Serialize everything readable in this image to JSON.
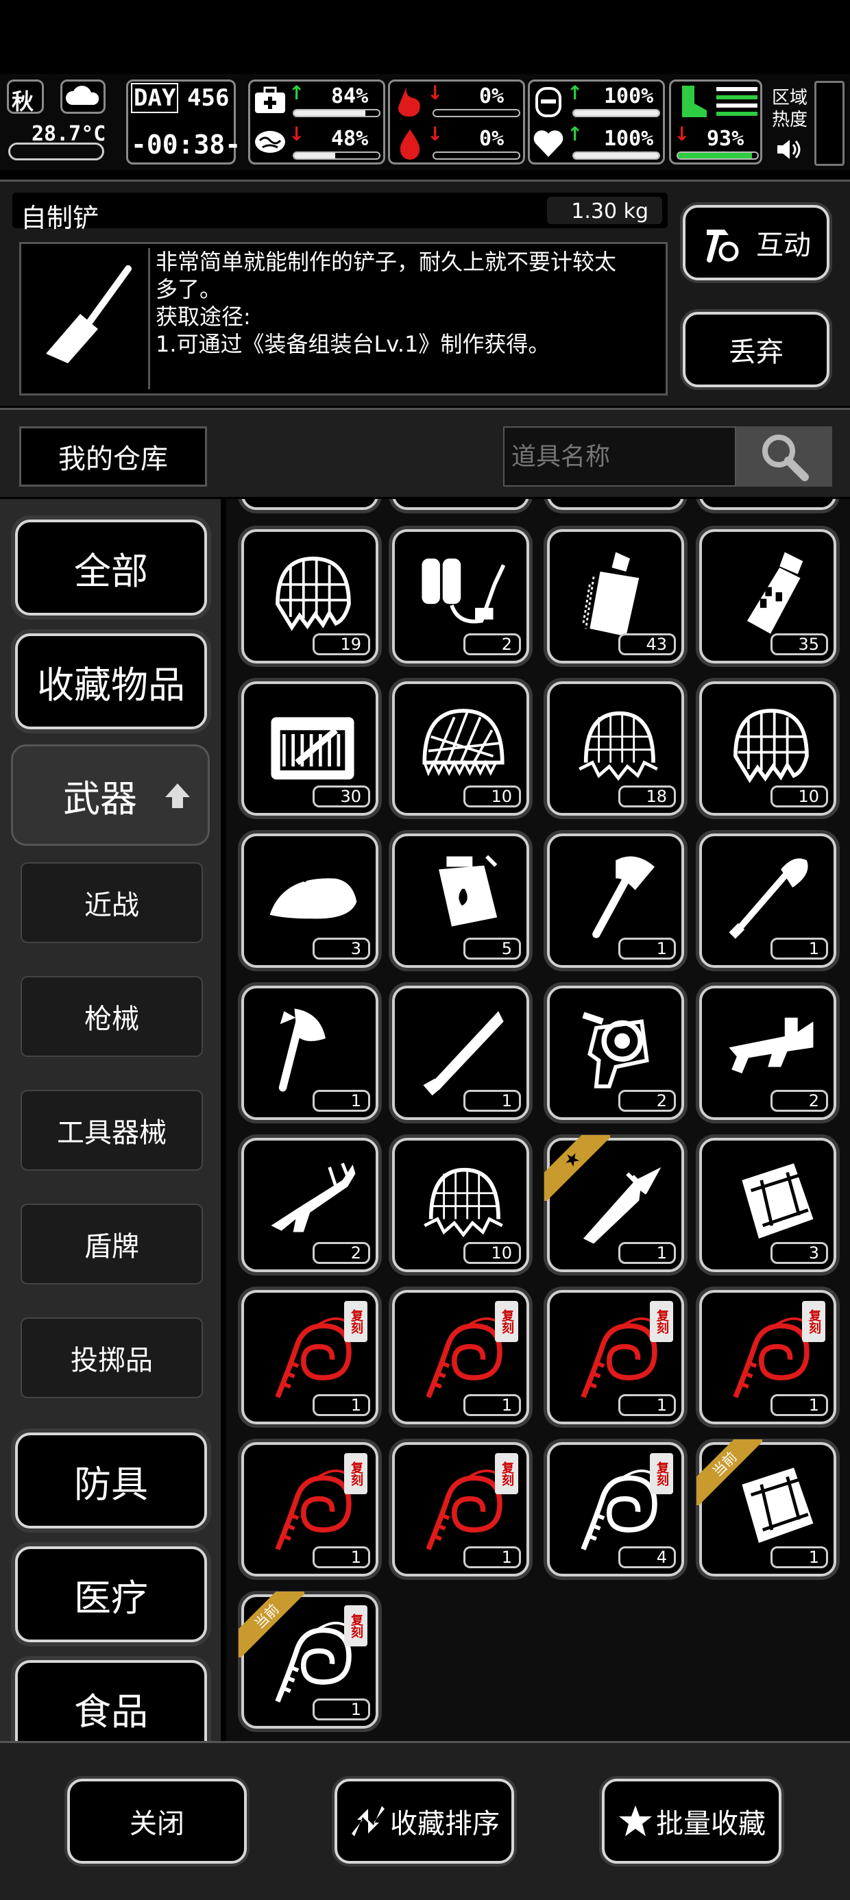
{
  "status": {
    "season": "秋",
    "temperature": "28.7°C",
    "day_label": "DAY",
    "day": "456",
    "clock": "-00:38-",
    "stats": [
      {
        "icon": "medkit-icon",
        "trend": "up",
        "value": "84%",
        "level": 0.84
      },
      {
        "icon": "brain-icon",
        "trend": "down",
        "value": "48%",
        "level": 0.48
      },
      {
        "icon": "stomach-icon",
        "trend": "down",
        "value": "0%",
        "level": 0
      },
      {
        "icon": "water-drop-icon",
        "trend": "down",
        "value": "0%",
        "level": 0
      },
      {
        "icon": "bladder-icon",
        "trend": "up",
        "value": "100%",
        "level": 1.0
      },
      {
        "icon": "heart-icon",
        "trend": "up",
        "value": "100%",
        "level": 1.0
      },
      {
        "icon": "boot-icon",
        "trend": "down",
        "value": "93%",
        "level": 0.93
      }
    ],
    "zone_heat_label": "区域热度",
    "zone_heat_line1": "区域",
    "zone_heat_line2": "热度",
    "sound_icon": "speaker-icon"
  },
  "detail": {
    "name": "自制铲",
    "weight": "1.30 kg",
    "description_line1": "非常简单就能制作的铲子，耐久上就不要计较太",
    "description_line2": "多了。",
    "source_title": "获取途径:",
    "source_item": "1.可通过《装备组装台Lv.1》制作获得。",
    "interact_label": "互动",
    "discard_label": "丢弃"
  },
  "search": {
    "warehouse_label": "我的仓库",
    "placeholder": "道具名称"
  },
  "sidebar": {
    "all": "全部",
    "favorites": "收藏物品",
    "weapons": "武器",
    "sub": [
      "近战",
      "枪械",
      "工具器械",
      "盾牌",
      "投掷品"
    ],
    "armor": "防具",
    "medical": "医疗",
    "food": "食品"
  },
  "grid": {
    "current_label": "当前",
    "replica_label": "复刻",
    "items": [
      {
        "icon": "helmet-net-icon",
        "count": "19"
      },
      {
        "icon": "flamethrower-icon",
        "count": "2"
      },
      {
        "icon": "chainsaw-grenade-icon",
        "count": "43"
      },
      {
        "icon": "flashbang-icon",
        "count": "35"
      },
      {
        "icon": "ammo-crate-icon",
        "count": "30"
      },
      {
        "icon": "spiked-net-icon",
        "count": "10"
      },
      {
        "icon": "spider-net-icon",
        "count": "18"
      },
      {
        "icon": "helmet-net-icon",
        "count": "10"
      },
      {
        "icon": "iron-icon",
        "count": "3"
      },
      {
        "icon": "explosive-pack-icon",
        "count": "5"
      },
      {
        "icon": "axe-icon",
        "count": "1"
      },
      {
        "icon": "shovel-icon",
        "count": "1"
      },
      {
        "icon": "hatchet-icon",
        "count": "1"
      },
      {
        "icon": "machete-icon",
        "count": "1"
      },
      {
        "icon": "sawblade-gun-icon",
        "count": "2"
      },
      {
        "icon": "heavy-gun-icon",
        "count": "2"
      },
      {
        "icon": "assault-rifle-icon",
        "count": "2"
      },
      {
        "icon": "spider-net-icon",
        "count": "10"
      },
      {
        "icon": "combat-knife-icon",
        "count": "1",
        "badge": "star"
      },
      {
        "icon": "backpack-icon",
        "count": "3"
      },
      {
        "icon": "red-whip-icon",
        "count": "1",
        "replica": true,
        "red": true
      },
      {
        "icon": "red-whip-icon",
        "count": "1",
        "replica": true,
        "red": true
      },
      {
        "icon": "red-whip-icon",
        "count": "1",
        "replica": true,
        "red": true
      },
      {
        "icon": "red-whip-icon",
        "count": "1",
        "replica": true,
        "red": true
      },
      {
        "icon": "red-whip-icon",
        "count": "1",
        "replica": true,
        "red": true
      },
      {
        "icon": "red-whip-icon",
        "count": "1",
        "replica": true,
        "red": true
      },
      {
        "icon": "white-whip-icon",
        "count": "4",
        "replica": true
      },
      {
        "icon": "backpack-icon",
        "count": "1",
        "badge": "current"
      },
      {
        "icon": "white-whip-icon",
        "count": "1",
        "replica": true,
        "badge": "current"
      }
    ]
  },
  "bottom": {
    "close_label": "关闭",
    "sort_label": "收藏排序",
    "batch_label": "批量收藏"
  },
  "colors": {
    "accent_green": "#2ecc40",
    "accent_red": "#e01a1a",
    "badge_gold": "#c99a2e"
  }
}
